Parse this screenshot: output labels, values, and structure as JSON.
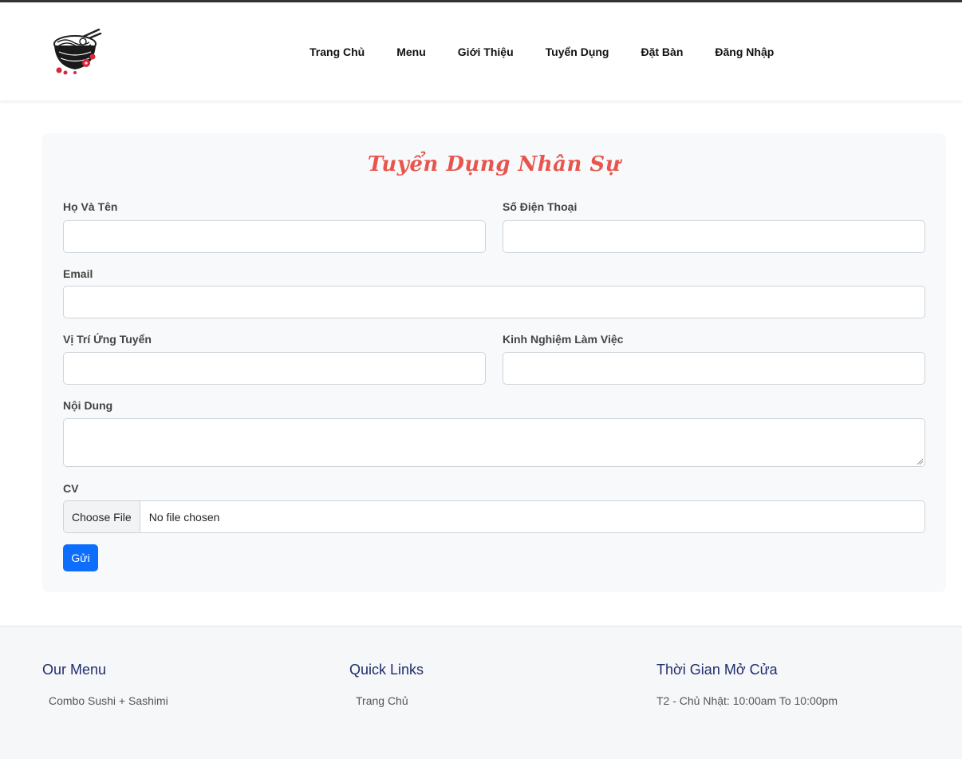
{
  "nav": {
    "items": [
      "Trang Chủ",
      "Menu",
      "Giới Thiệu",
      "Tuyển Dụng",
      "Đặt Bàn",
      "Đăng Nhập"
    ]
  },
  "form": {
    "title": "Tuyển Dụng Nhân Sự",
    "name_label": "Họ Và Tên",
    "phone_label": "Số Điện Thoại",
    "email_label": "Email",
    "position_label": "Vị Trí Ứng Tuyển",
    "experience_label": "Kinh Nghiệm Làm Việc",
    "content_label": "Nội Dung",
    "cv_label": "CV",
    "file_button": "Choose File",
    "file_status": "No file chosen",
    "submit_label": "Gửi"
  },
  "footer": {
    "columns": [
      {
        "title": "Our Menu",
        "item": "Combo Sushi + Sashimi"
      },
      {
        "title": "Quick Links",
        "item": "Trang Chủ"
      },
      {
        "title": "Thời Gian Mở Cửa",
        "item": "T2 - Chủ Nhật: 10:00am To 10:00pm"
      }
    ]
  },
  "colors": {
    "title": "#e8554e",
    "primary_button": "#0d6efd",
    "footer_heading": "#1f2d6b"
  }
}
